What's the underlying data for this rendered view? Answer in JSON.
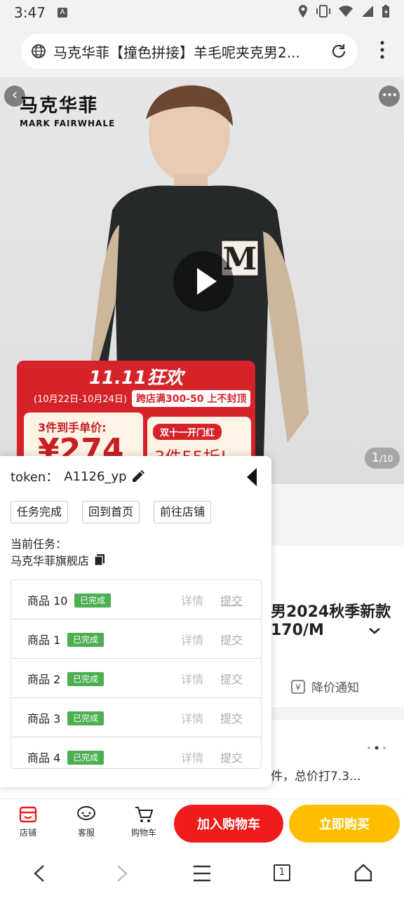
{
  "status": {
    "time": "3:47",
    "a_icon": "A"
  },
  "browser": {
    "title": "马克华菲【撞色拼接】羊毛呢夹克男2...",
    "icons": [
      "globe-icon",
      "reload-icon",
      "more-vert-icon"
    ]
  },
  "hero": {
    "brand_cn": "马克华菲",
    "brand_en": "MARK FAIRWHALE",
    "counter_current": "1",
    "counter_total": "/10",
    "promo": {
      "headline": "11.11狂欢",
      "date": "(10月22日-10月24日)",
      "deal": "跨店满300-50 上不封顶",
      "card_label": "3件到手单价:",
      "card_price": "¥274",
      "card2_tag": "双十一开门红",
      "card2_text": "3件55折!"
    }
  },
  "page_behind": {
    "title_line1": "男2024秋季新款",
    "title_line2": "170/M",
    "price_alert": "降价通知",
    "promo_text": "件，总价打7.3..."
  },
  "bottom_bar": {
    "shop": "店铺",
    "service": "客服",
    "cart": "购物车",
    "add_to_cart": "加入购物车",
    "buy_now": "立即购买"
  },
  "panel": {
    "token_label": "token：",
    "token_value": "A1126_yp",
    "buttons": {
      "task_done": "任务完成",
      "home": "回到首页",
      "go_store": "前往店铺"
    },
    "current_task_label": "当前任务：",
    "store_name": "马克华菲旗舰店",
    "items": [
      {
        "name": "商品 10",
        "status": "已完成",
        "detail": "详情",
        "submit": "提交"
      },
      {
        "name": "商品 1",
        "status": "已完成",
        "detail": "详情",
        "submit": "提交"
      },
      {
        "name": "商品 2",
        "status": "已完成",
        "detail": "详情",
        "submit": "提交"
      },
      {
        "name": "商品 3",
        "status": "已完成",
        "detail": "详情",
        "submit": "提交"
      },
      {
        "name": "商品 4",
        "status": "已完成",
        "detail": "详情",
        "submit": "提交"
      }
    ]
  },
  "sysnav": {
    "tab_count": "1"
  },
  "colors": {
    "red": "#f01c1c",
    "yellow": "#ffbf00",
    "badge_green": "#4caf50",
    "promo_red": "#d6232a"
  }
}
